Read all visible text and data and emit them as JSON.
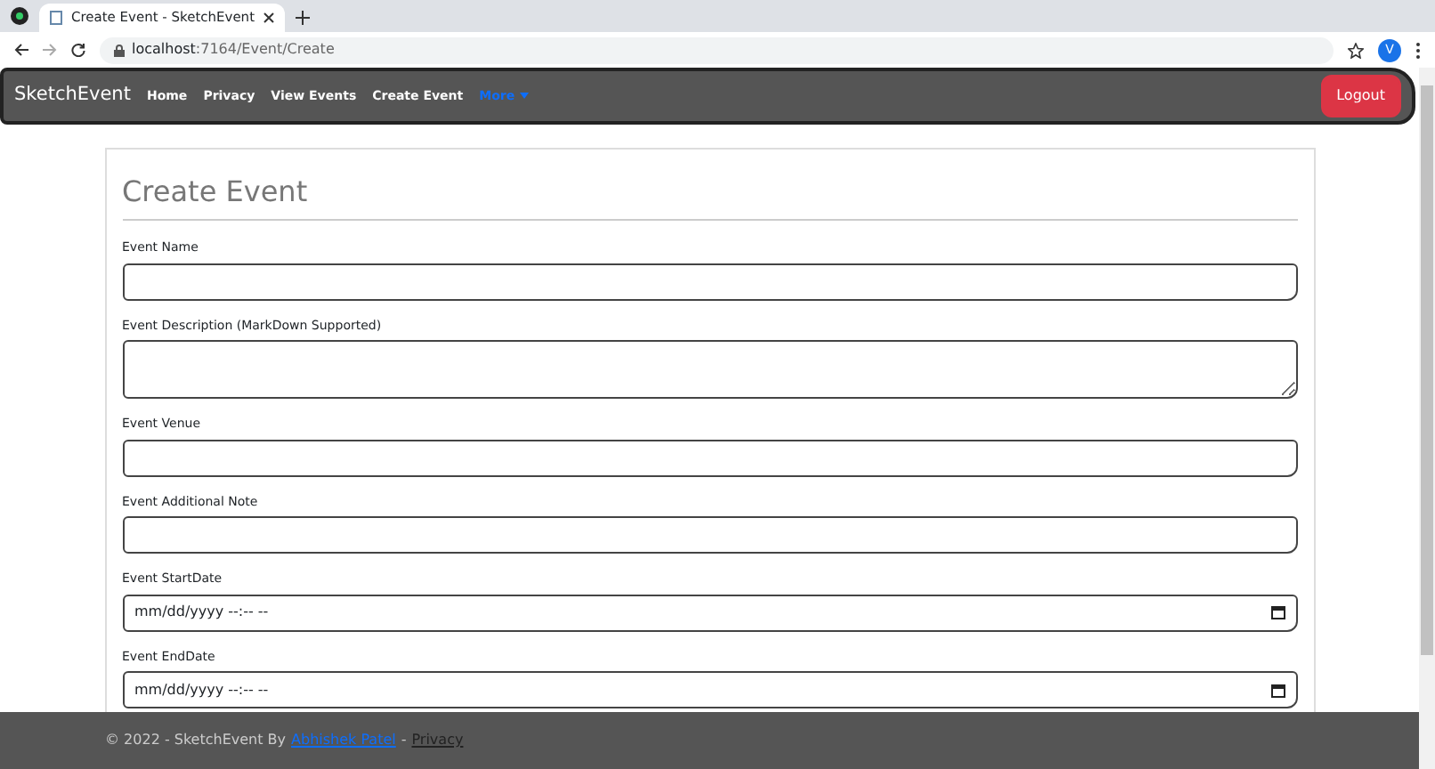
{
  "browser": {
    "tab_title": "Create Event - SketchEvent",
    "url_host": "localhost",
    "url_path": ":7164/Event/Create",
    "profile_initial": "V"
  },
  "navbar": {
    "brand": "SketchEvent",
    "links": [
      {
        "label": "Home",
        "kind": "link"
      },
      {
        "label": "Privacy",
        "kind": "link"
      },
      {
        "label": "View Events",
        "kind": "link"
      },
      {
        "label": "Create Event",
        "kind": "link"
      },
      {
        "label": "More",
        "kind": "dropdown"
      }
    ],
    "logout": "Logout"
  },
  "form": {
    "title": "Create Event",
    "fields": [
      {
        "label": "Event Name",
        "kind": "text"
      },
      {
        "label": "Event Description (MarkDown Supported)",
        "kind": "textarea"
      },
      {
        "label": "Event Venue",
        "kind": "text"
      },
      {
        "label": "Event Additional Note",
        "kind": "text"
      },
      {
        "label": "Event StartDate",
        "kind": "datetime",
        "value": "mm/dd/yyyy --:-- --"
      },
      {
        "label": "Event EndDate",
        "kind": "datetime",
        "value": "mm/dd/yyyy --:-- --"
      }
    ]
  },
  "footer": {
    "copyright": "© 2022 - SketchEvent By",
    "author": "Abhishek Patel",
    "separator": "-",
    "privacy": "Privacy"
  }
}
